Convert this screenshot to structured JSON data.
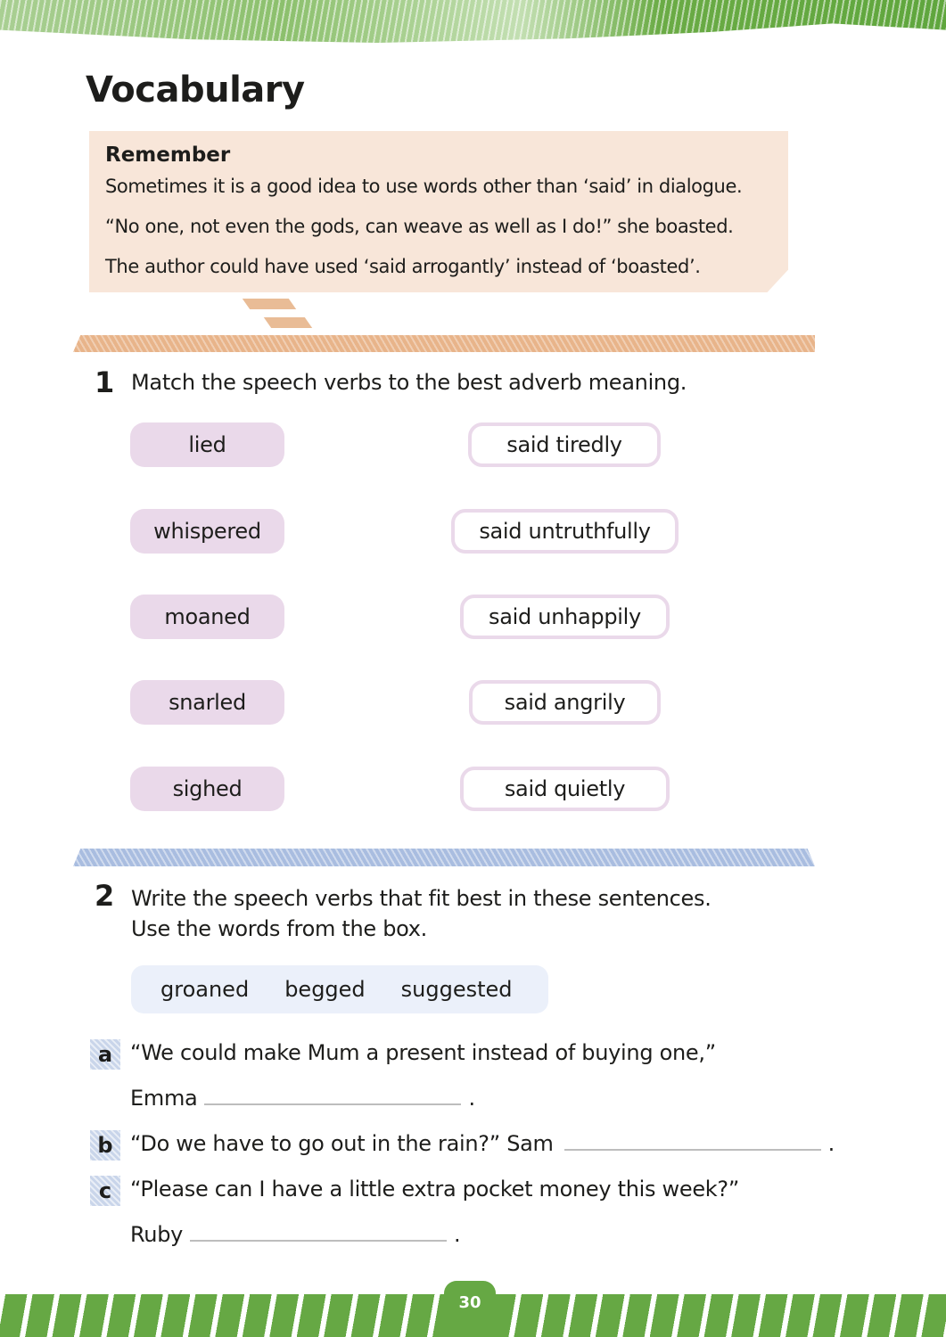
{
  "page": {
    "title": "Vocabulary",
    "page_number": "30"
  },
  "remember": {
    "heading": "Remember",
    "lines": [
      "Sometimes it is a good idea to use words other than ‘said’ in dialogue.",
      "“No one, not even the gods, can weave as well as I do!” she boasted.",
      "The author could have used ‘said arrogantly’ instead of ‘boasted’."
    ]
  },
  "question1": {
    "number": "1",
    "instruction": "Match the speech verbs to the best adverb meaning.",
    "verbs": [
      "lied",
      "whispered",
      "moaned",
      "snarled",
      "sighed"
    ],
    "adverbs": [
      "said tiredly",
      "said untruthfully",
      "said unhappily",
      "said angrily",
      "said quietly"
    ]
  },
  "question2": {
    "number": "2",
    "instruction_line1": "Write the speech verbs that fit best in these sentences.",
    "instruction_line2": "Use the words from the box.",
    "word_box": [
      "groaned",
      "begged",
      "suggested"
    ],
    "items": [
      {
        "label": "a",
        "text": "“We could make Mum a present instead of buying one,”",
        "speaker": "Emma",
        "answer": "",
        "end": "."
      },
      {
        "label": "b",
        "text": "“Do we have to go out in the rain?” Sam",
        "answer": "",
        "end": "."
      },
      {
        "label": "c",
        "text": "“Please can I have a little extra pocket money this week?”",
        "speaker": "Ruby",
        "answer": "",
        "end": "."
      }
    ]
  },
  "colors": {
    "brand_green": "#66a844",
    "remember_bg": "#f8e6d9",
    "verb_pill": "#ead9ea",
    "word_box_bg": "#ebf0fa",
    "orange_stripe": "#e8b48a",
    "blue_stripe": "#a9bde0"
  }
}
